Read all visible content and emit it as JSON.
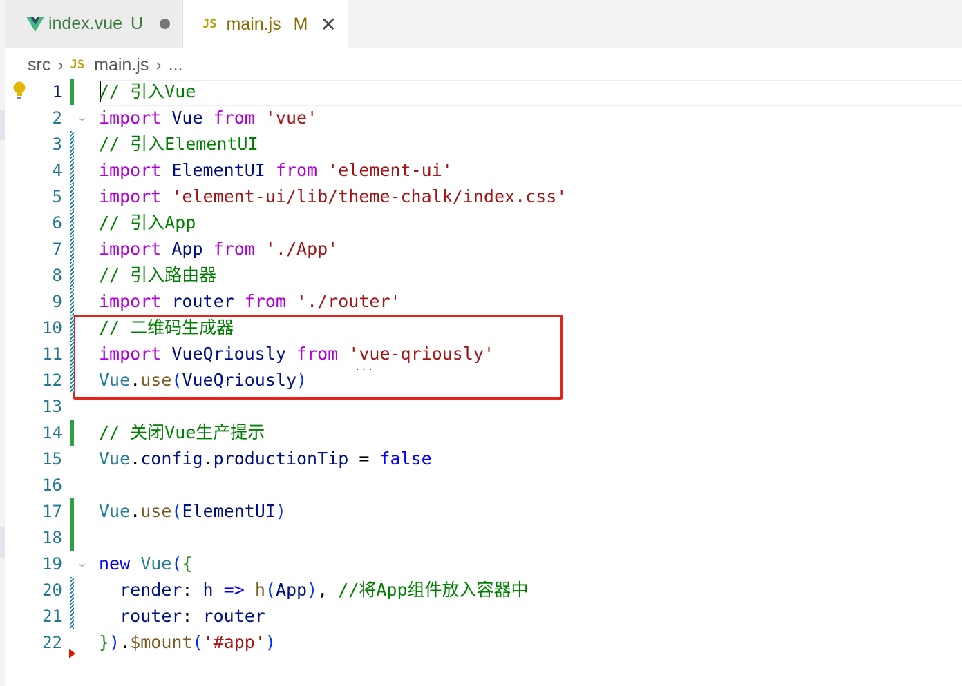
{
  "tabs": [
    {
      "icon": "vue-icon",
      "label": "index.vue",
      "status": "U",
      "dirty": true
    },
    {
      "icon": "js-icon",
      "badge": "JS",
      "label": "main.js",
      "status": "M",
      "active": true
    }
  ],
  "breadcrumb": {
    "folder": "src",
    "badge": "JS",
    "file": "main.js",
    "more": "..."
  },
  "editor": {
    "active_line": 1,
    "lines": [
      {
        "n": "1",
        "tokens": [
          {
            "t": "// 引入Vue",
            "c": "cm"
          }
        ]
      },
      {
        "n": "2",
        "tokens": [
          {
            "t": "import",
            "c": "kw"
          },
          {
            "t": " "
          },
          {
            "t": "Vue",
            "c": "vr"
          },
          {
            "t": " "
          },
          {
            "t": "from",
            "c": "kw"
          },
          {
            "t": " "
          },
          {
            "t": "'vue'",
            "c": "str"
          }
        ]
      },
      {
        "n": "3",
        "tokens": [
          {
            "t": "// 引入ElementUI",
            "c": "cm"
          }
        ]
      },
      {
        "n": "4",
        "tokens": [
          {
            "t": "import",
            "c": "kw"
          },
          {
            "t": " "
          },
          {
            "t": "ElementUI",
            "c": "vr"
          },
          {
            "t": " "
          },
          {
            "t": "from",
            "c": "kw"
          },
          {
            "t": " "
          },
          {
            "t": "'element-ui'",
            "c": "str"
          }
        ]
      },
      {
        "n": "5",
        "tokens": [
          {
            "t": "import",
            "c": "kw"
          },
          {
            "t": " "
          },
          {
            "t": "'element-ui/lib/theme-chalk/index.css'",
            "c": "str"
          }
        ]
      },
      {
        "n": "6",
        "tokens": [
          {
            "t": "// 引入App",
            "c": "cm"
          }
        ]
      },
      {
        "n": "7",
        "tokens": [
          {
            "t": "import",
            "c": "kw"
          },
          {
            "t": " "
          },
          {
            "t": "App",
            "c": "vr"
          },
          {
            "t": " "
          },
          {
            "t": "from",
            "c": "kw"
          },
          {
            "t": " "
          },
          {
            "t": "'./App'",
            "c": "str"
          }
        ]
      },
      {
        "n": "8",
        "tokens": [
          {
            "t": "// 引入路由器",
            "c": "cm"
          }
        ]
      },
      {
        "n": "9",
        "tokens": [
          {
            "t": "import",
            "c": "kw"
          },
          {
            "t": " "
          },
          {
            "t": "router",
            "c": "vr"
          },
          {
            "t": " "
          },
          {
            "t": "from",
            "c": "kw"
          },
          {
            "t": " "
          },
          {
            "t": "'./router'",
            "c": "str"
          }
        ]
      },
      {
        "n": "10",
        "tokens": [
          {
            "t": "// 二维码生成器",
            "c": "cm"
          }
        ]
      },
      {
        "n": "11",
        "tokens": [
          {
            "t": "import",
            "c": "kw"
          },
          {
            "t": " "
          },
          {
            "t": "VueQriously",
            "c": "vr"
          },
          {
            "t": " "
          },
          {
            "t": "from",
            "c": "kw"
          },
          {
            "t": " "
          },
          {
            "t": "'vue-qriously'",
            "c": "str"
          }
        ]
      },
      {
        "n": "12",
        "tokens": [
          {
            "t": "Vue",
            "c": "ty"
          },
          {
            "t": "."
          },
          {
            "t": "use",
            "c": "fn"
          },
          {
            "t": "(",
            "c": "b1"
          },
          {
            "t": "VueQriously",
            "c": "vr"
          },
          {
            "t": ")",
            "c": "b1"
          }
        ]
      },
      {
        "n": "13",
        "tokens": []
      },
      {
        "n": "14",
        "tokens": [
          {
            "t": "// 关闭Vue生产提示",
            "c": "cm"
          }
        ]
      },
      {
        "n": "15",
        "tokens": [
          {
            "t": "Vue",
            "c": "ty"
          },
          {
            "t": "."
          },
          {
            "t": "config",
            "c": "vr"
          },
          {
            "t": "."
          },
          {
            "t": "productionTip",
            "c": "vr"
          },
          {
            "t": " = "
          },
          {
            "t": "false",
            "c": "bl"
          }
        ]
      },
      {
        "n": "16",
        "tokens": []
      },
      {
        "n": "17",
        "tokens": [
          {
            "t": "Vue",
            "c": "ty"
          },
          {
            "t": "."
          },
          {
            "t": "use",
            "c": "fn"
          },
          {
            "t": "(",
            "c": "b1"
          },
          {
            "t": "ElementUI",
            "c": "vr"
          },
          {
            "t": ")",
            "c": "b1"
          }
        ]
      },
      {
        "n": "18",
        "tokens": []
      },
      {
        "n": "19",
        "tokens": [
          {
            "t": "new",
            "c": "bl"
          },
          {
            "t": " "
          },
          {
            "t": "Vue",
            "c": "ty"
          },
          {
            "t": "(",
            "c": "b1"
          },
          {
            "t": "{",
            "c": "b2"
          }
        ]
      },
      {
        "n": "20",
        "tokens": [
          {
            "t": "  "
          },
          {
            "t": "render",
            "c": "vr"
          },
          {
            "t": ": "
          },
          {
            "t": "h",
            "c": "vr"
          },
          {
            "t": " "
          },
          {
            "t": "=>",
            "c": "bl"
          },
          {
            "t": " "
          },
          {
            "t": "h",
            "c": "fn"
          },
          {
            "t": "(",
            "c": "b1"
          },
          {
            "t": "App",
            "c": "vr"
          },
          {
            "t": ")",
            "c": "b1"
          },
          {
            "t": ", "
          },
          {
            "t": "//将App组件放入容器中",
            "c": "cm"
          }
        ]
      },
      {
        "n": "21",
        "tokens": [
          {
            "t": "  "
          },
          {
            "t": "router",
            "c": "vr"
          },
          {
            "t": ": "
          },
          {
            "t": "router",
            "c": "vr"
          }
        ]
      },
      {
        "n": "22",
        "tokens": [
          {
            "t": "}",
            "c": "b2"
          },
          {
            "t": ")",
            "c": "b1"
          },
          {
            "t": "."
          },
          {
            "t": "$mount",
            "c": "fn"
          },
          {
            "t": "(",
            "c": "b1"
          },
          {
            "t": "'#app'",
            "c": "str"
          },
          {
            "t": ")",
            "c": "b1"
          }
        ]
      }
    ],
    "gutter_markers": {
      "1": "add",
      "3": "mod",
      "4": "mod",
      "5": "mod",
      "6": "mod",
      "7": "mod",
      "8": "mod",
      "9": "mod",
      "10": "mod",
      "11": "mod",
      "12": "mod",
      "14": "add",
      "17": "add",
      "18": "add",
      "20": "mod",
      "21": "mod"
    },
    "fold_lines": [
      "2",
      "19"
    ],
    "highlight_box_lines": [
      "10",
      "11",
      "12"
    ],
    "hint_ellipsis": "...",
    "colors": {
      "comment": "#008000",
      "keyword": "#af00db",
      "string": "#a31515",
      "blue": "#0000ff",
      "variable": "#001080",
      "type": "#267f99",
      "function": "#795e26",
      "added": "#2ea043",
      "modified": "#1b81a8",
      "highlight_box": "#e2251f"
    }
  }
}
